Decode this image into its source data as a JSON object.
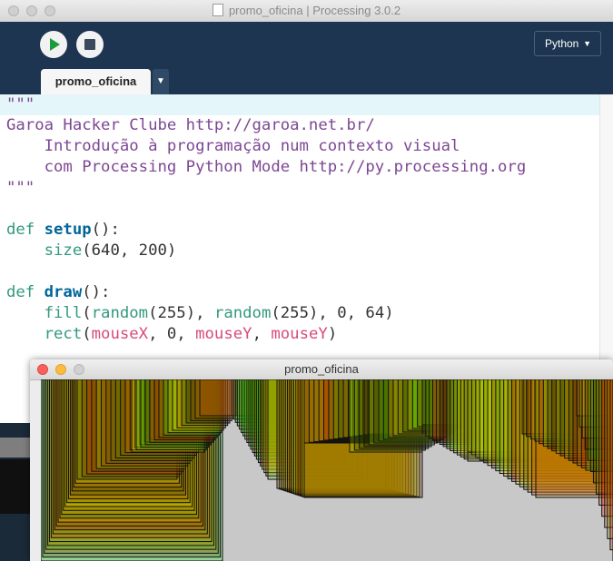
{
  "window": {
    "title": "promo_oficina | Processing 3.0.2"
  },
  "toolbar": {
    "mode_label": "Python",
    "mode_arrow": "▼"
  },
  "tabs": [
    {
      "label": "promo_oficina"
    }
  ],
  "tab_menu_glyph": "▼",
  "code_lines": [
    "\"\"\"",
    "Garoa Hacker Clube http://garoa.net.br/",
    "    Introdução à programação num contexto visual",
    "    com Processing Python Mode http://py.processing.org",
    "\"\"\"",
    "",
    "def setup():",
    "    size(640, 200)",
    "",
    "def draw():",
    "    fill(random(255), random(255), 0, 64)",
    "    rect(mouseX, 0, mouseY, mouseY)"
  ],
  "sketch_window": {
    "title": "promo_oficina"
  },
  "colors": {
    "toolbar_bg": "#1d3550",
    "run_green": "#1c9b39",
    "string_purple": "#7d4793",
    "keyword_teal": "#33997e"
  }
}
